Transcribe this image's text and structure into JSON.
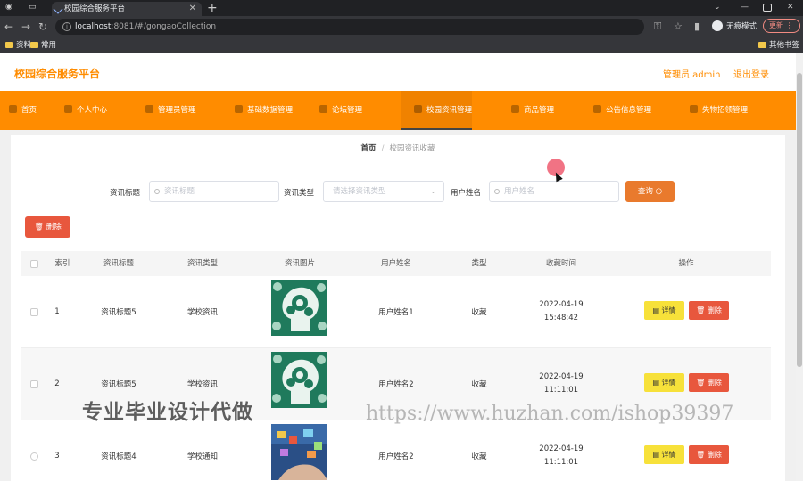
{
  "browser": {
    "tab_title": "校园综合服务平台",
    "url_host": "localhost",
    "url_rest": ":8081/#/gongaoCollection",
    "guest_label": "无痕模式",
    "update_label": "更新",
    "bookmarks": [
      "资料",
      "常用"
    ],
    "other_bookmarks": "其他书签"
  },
  "header": {
    "brand": "校园综合服务平台",
    "admin_label": "管理员 admin",
    "logout_label": "退出登录"
  },
  "nav": [
    {
      "label": "首页"
    },
    {
      "label": "个人中心"
    },
    {
      "label": "管理员管理"
    },
    {
      "label": "基础数据管理"
    },
    {
      "label": "论坛管理"
    },
    {
      "label": "校园资讯管理"
    },
    {
      "label": "商品管理"
    },
    {
      "label": "公告信息管理"
    },
    {
      "label": "失物招领管理"
    }
  ],
  "breadcrumb": {
    "home": "首页",
    "current": "校园资讯收藏"
  },
  "filters": {
    "title_label": "资讯标题",
    "title_placeholder": "资讯标题",
    "type_label": "资讯类型",
    "type_placeholder": "请选择资讯类型",
    "user_label": "用户姓名",
    "user_placeholder": "用户姓名",
    "query_label": "查询"
  },
  "delete_label": "删除",
  "table": {
    "headers": [
      "索引",
      "资讯标题",
      "资讯类型",
      "资讯图片",
      "用户姓名",
      "类型",
      "收藏时间",
      "操作"
    ],
    "detail_label": "详情",
    "delete_label": "删除",
    "rows": [
      {
        "index": "1",
        "title": "资讯标题5",
        "type": "学校资讯",
        "user": "用户姓名1",
        "kind": "收藏",
        "time": "2022-04-19 15:48:42",
        "image": "brain-gears-image"
      },
      {
        "index": "2",
        "title": "资讯标题5",
        "type": "学校资讯",
        "user": "用户姓名2",
        "kind": "收藏",
        "time": "2022-04-19 11:11:01",
        "image": "brain-gears-image"
      },
      {
        "index": "3",
        "title": "资讯标题4",
        "type": "学校通知",
        "user": "用户姓名2",
        "kind": "收藏",
        "time": "2022-04-19 11:11:01",
        "image": "tech-hand-image"
      }
    ]
  },
  "watermarks": {
    "left": "专业毕业设计代做",
    "right": "https://www.huzhan.com/ishop39397"
  },
  "colors": {
    "accent": "#ff8c00",
    "danger": "#e8573d",
    "warning": "#f7e13a",
    "query": "#e97a2d"
  }
}
